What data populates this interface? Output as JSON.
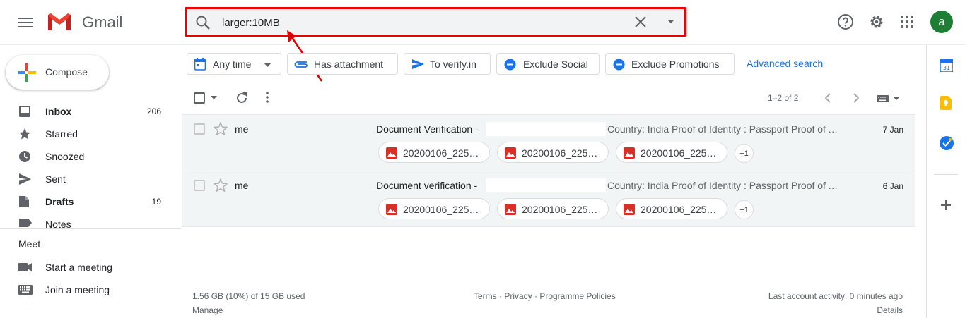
{
  "header": {
    "brand": "Gmail",
    "search_value": "larger:10MB",
    "avatar_letter": "a"
  },
  "sidebar": {
    "compose_label": "Compose",
    "items": [
      {
        "label": "Inbox",
        "count": "206",
        "bold": true,
        "icon": "inbox-icon"
      },
      {
        "label": "Starred",
        "count": "",
        "bold": false,
        "icon": "star-icon"
      },
      {
        "label": "Snoozed",
        "count": "",
        "bold": false,
        "icon": "clock-icon"
      },
      {
        "label": "Sent",
        "count": "",
        "bold": false,
        "icon": "send-icon"
      },
      {
        "label": "Drafts",
        "count": "19",
        "bold": true,
        "icon": "draft-icon"
      },
      {
        "label": "Notes",
        "count": "",
        "bold": false,
        "icon": "label-icon"
      }
    ],
    "meet": {
      "title": "Meet",
      "items": [
        {
          "label": "Start a meeting",
          "icon": "video-icon"
        },
        {
          "label": "Join a meeting",
          "icon": "keyboard-icon"
        }
      ]
    }
  },
  "filters": {
    "chips": [
      "Any time",
      "Has attachment",
      "To verify.in",
      "Exclude Social",
      "Exclude Promotions"
    ],
    "advanced": "Advanced search"
  },
  "toolbar": {
    "pagination": "1–2 of 2"
  },
  "emails": [
    {
      "sender": "me",
      "subject": "Document Verification -",
      "snippet": "Country: India Proof of Identity : Passport Proof of Address",
      "date": "7 Jan",
      "attachments": [
        "20200106_225…",
        "20200106_225…",
        "20200106_225…"
      ],
      "more": "+1"
    },
    {
      "sender": "me",
      "subject": "Document verification -",
      "snippet": "Country: India Proof of Identity : Passport Proof of Address",
      "date": "6 Jan",
      "attachments": [
        "20200106_225…",
        "20200106_225…",
        "20200106_225…"
      ],
      "more": "+1"
    }
  ],
  "footer": {
    "storage": "1.56 GB (10%) of 15 GB used",
    "manage": "Manage",
    "policies": "Terms · Privacy · Programme Policies",
    "activity": "Last account activity: 0 minutes ago",
    "details": "Details"
  },
  "colors": {
    "accent": "#1a73e8",
    "annotation": "#e00000",
    "avatar": "#1e7e34"
  }
}
